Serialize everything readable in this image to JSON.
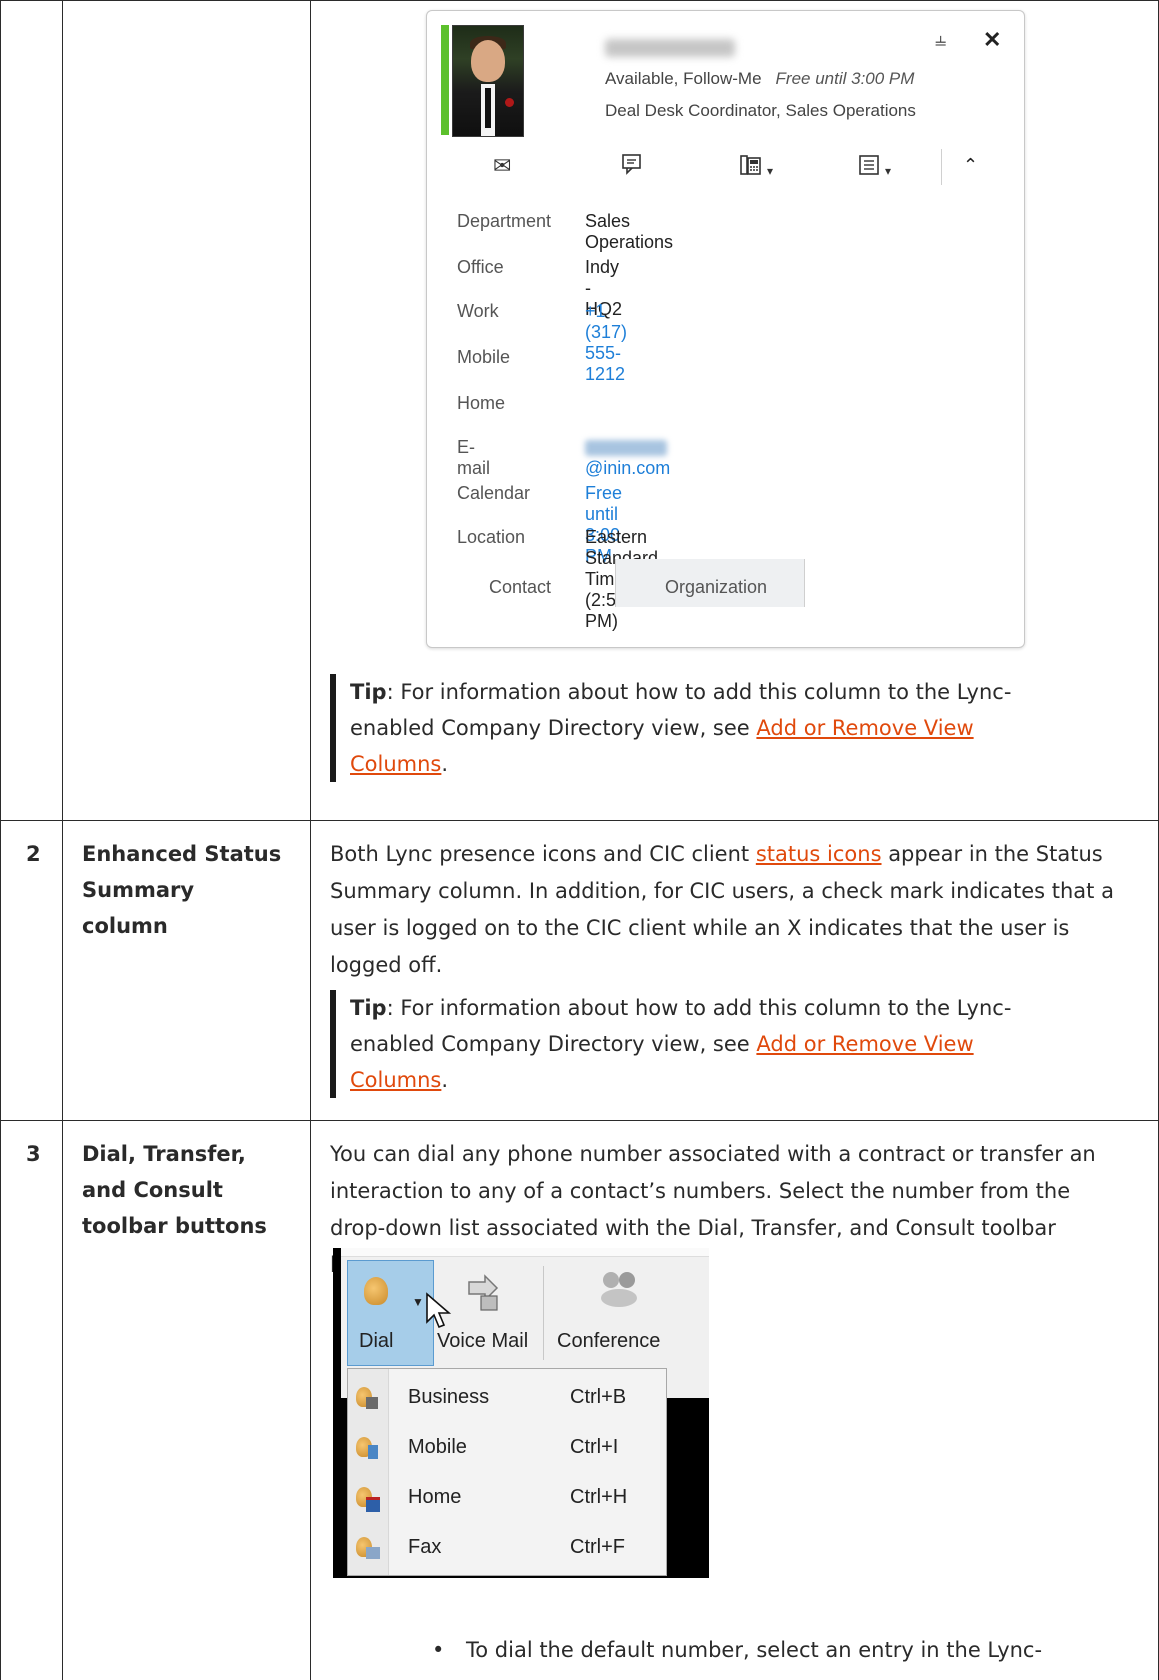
{
  "card": {
    "status": "Available, Follow-Me",
    "free": "Free until 3:00 PM",
    "title": "Deal Desk Coordinator, Sales Operations",
    "actions": {
      "email_icon": "envelope-icon",
      "im_icon": "chat-icon",
      "call_icon": "phone-icon",
      "more_icon": "list-icon",
      "collapse_icon": "chevron-up-icon"
    },
    "details": [
      {
        "label": "Department",
        "value": "Sales Operations"
      },
      {
        "label": "Office",
        "value": "Indy - HQ2"
      },
      {
        "label": "Work",
        "value": "+1 (317) 555-1212"
      },
      {
        "label": "Mobile",
        "value": ""
      },
      {
        "label": "Home",
        "value": ""
      },
      {
        "label": "E-mail",
        "value": "@inin.com"
      },
      {
        "label": "Calendar",
        "value": "Free until 3:00 PM"
      },
      {
        "label": "Location",
        "value": "Eastern Standard Time (2:50 PM)"
      }
    ],
    "tabs": [
      "Contact",
      "Organization"
    ]
  },
  "tip1": {
    "bold": "Tip",
    "text": ": For information about how to add this column to the Lync-enabled Company Directory view, see ",
    "link": "Add or Remove View Columns",
    "end": "."
  },
  "row2": {
    "num": "2",
    "title": "Enhanced Status Summary column",
    "text_before": "Both Lync presence icons and CIC client ",
    "link": "status icons",
    "text_after": " appear in the Status Summary column. In addition, for CIC users, a check mark indicates that a user is logged on to the CIC client while an X indicates that the user is logged off.",
    "tip_bold": "Tip",
    "tip_text": ": For information about how to add this column to the Lync-enabled Company Directory view, see ",
    "tip_link": "Add or Remove View Columns",
    "tip_end": "."
  },
  "row3": {
    "num": "3",
    "title": "Dial, Transfer, and Consult toolbar buttons",
    "text": "You can dial any phone number associated with a contract or transfer an interaction to any of a contact’s numbers. Select the number from the drop-down list associated with the Dial, Transfer, and Consult toolbar buttons.",
    "bullet": "To dial the default number, select an entry in the Lync-"
  },
  "toolbar": {
    "dial": "Dial",
    "voicemail": "Voice Mail",
    "conference": "Conference",
    "menu": [
      {
        "label": "Business",
        "shortcut": "Ctrl+B"
      },
      {
        "label": "Mobile",
        "shortcut": "Ctrl+I"
      },
      {
        "label": "Home",
        "shortcut": "Ctrl+H"
      },
      {
        "label": "Fax",
        "shortcut": "Ctrl+F"
      }
    ]
  }
}
